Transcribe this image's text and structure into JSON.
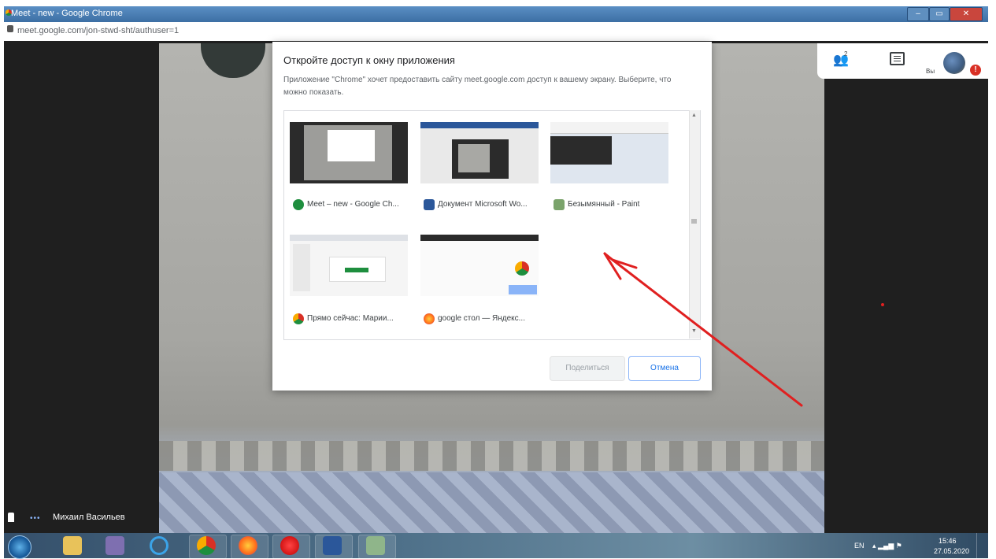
{
  "window": {
    "title": "Meet - new - Google Chrome",
    "url": "meet.google.com/jon-stwd-sht/authuser=1",
    "controls": [
      "–",
      "▭",
      "✕"
    ]
  },
  "meet": {
    "people_count": "2",
    "you_label": "Вы",
    "alert": "!",
    "participant_name": "Михаил Васильев",
    "dots": "•••"
  },
  "dialog": {
    "title": "Откройте доступ к окну приложения",
    "description": "Приложение \"Chrome\" хочет предоставить сайту meet.google.com доступ к вашему экрану. Выберите, что можно показать.",
    "windows": [
      {
        "label": "Meet – new - Google Ch...",
        "icon": "meet-icon"
      },
      {
        "label": "Документ Microsoft Wo...",
        "icon": "word-icon"
      },
      {
        "label": "Безымянный - Paint",
        "icon": "paint-icon"
      },
      {
        "label": "Прямо сейчас: Марии...",
        "icon": "chrome-icon"
      },
      {
        "label": "google стол — Яндекс...",
        "icon": "firefox-icon"
      }
    ],
    "share_button": "Поделиться",
    "cancel_button": "Отмена"
  },
  "taskbar": {
    "lang": "EN",
    "time": "15:46",
    "date": "27.05.2020",
    "apps": [
      "explorer",
      "media-player",
      "internet-explorer",
      "chrome",
      "firefox",
      "yandex-browser",
      "word",
      "paint"
    ]
  },
  "colors": {
    "accent": "#1a73e8",
    "arrow": "#e02020",
    "meet_bg": "#1f1f1f"
  }
}
